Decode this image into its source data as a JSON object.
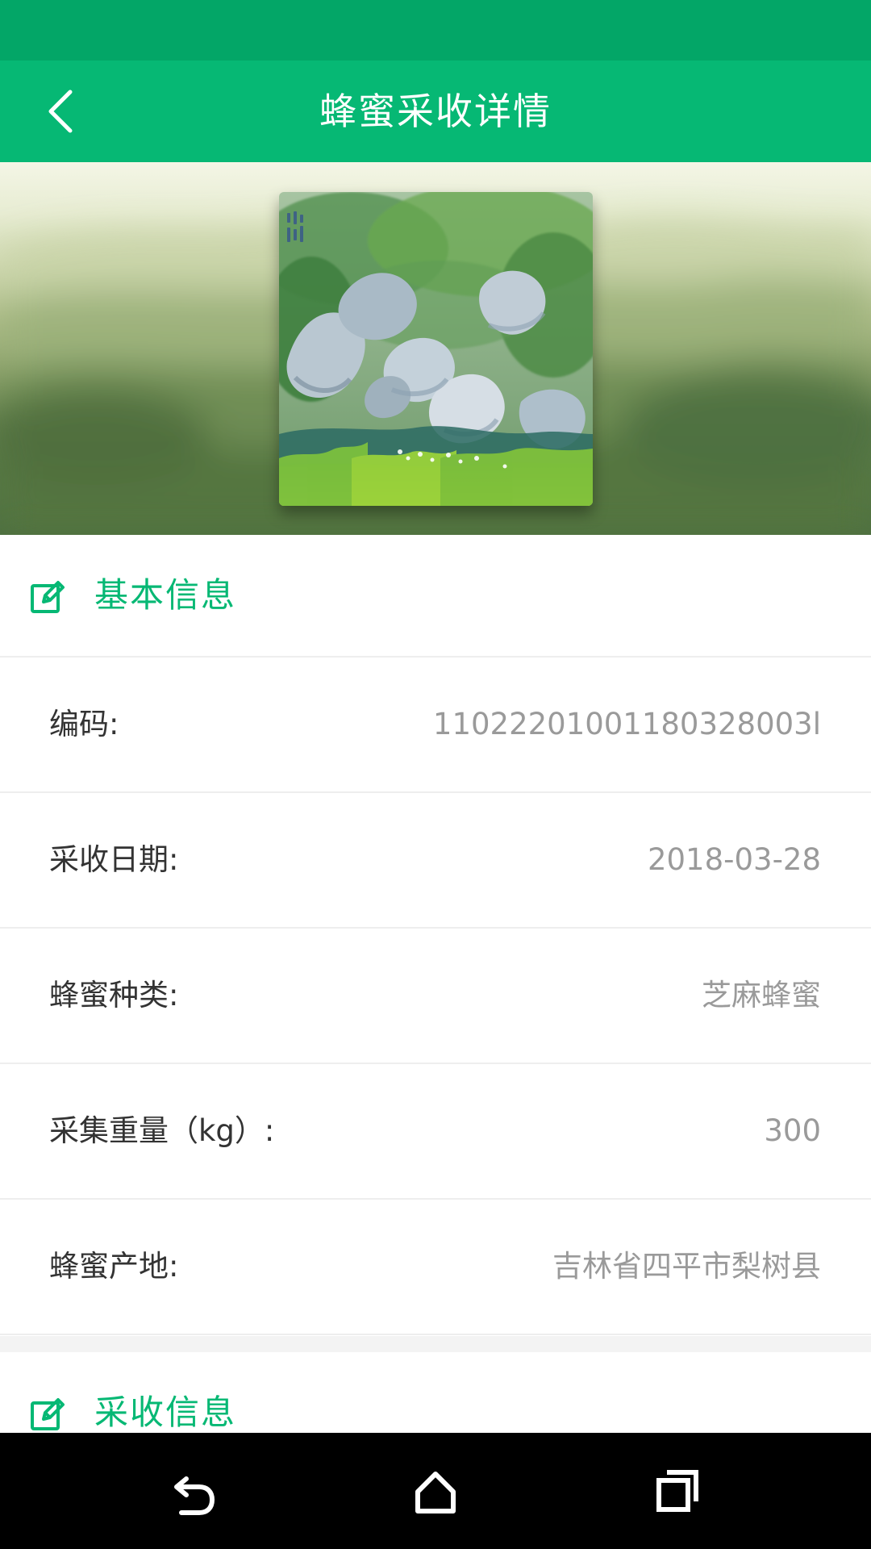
{
  "app": {
    "title": "蜂蜜采收详情",
    "accent_color": "#06b874",
    "status_bar_color": "#03a667"
  },
  "hero": {
    "photo": "landscape-painting-rocks-stream-trees"
  },
  "basic_info": {
    "title": "基本信息",
    "icon": "edit-icon",
    "rows": [
      {
        "label": "编码:",
        "value": "11022201001180328003l"
      },
      {
        "label": "采收日期:",
        "value": "2018-03-28"
      },
      {
        "label": "蜂蜜种类:",
        "value": "芝麻蜂蜜"
      },
      {
        "label": "采集重量（kg）:",
        "value": "300"
      },
      {
        "label": "蜂蜜产地:",
        "value": "吉林省四平市梨树县"
      }
    ]
  },
  "harvest_info": {
    "title": "采收信息",
    "icon": "edit-icon"
  },
  "nav": {
    "back": "back-icon",
    "home": "home-icon",
    "recents": "recents-icon"
  }
}
